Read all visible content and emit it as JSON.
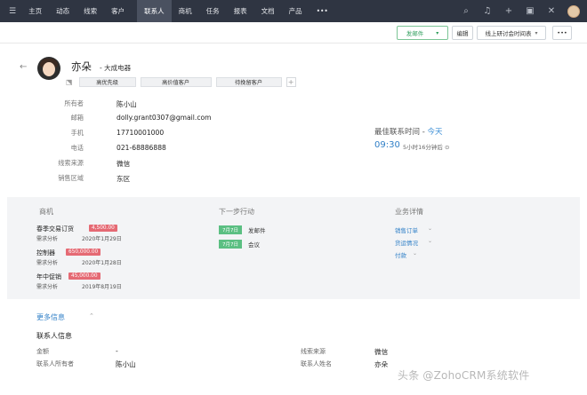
{
  "topnav": {
    "items": [
      "主页",
      "动态",
      "线索",
      "客户",
      "联系人",
      "商机",
      "任务",
      "报表",
      "文档",
      "产品",
      "•••"
    ],
    "active_index": 4
  },
  "actionbar": {
    "send_email": "发邮件",
    "send_email_caret": "▾",
    "edit": "编辑",
    "meeting": "线上研讨会时间表",
    "meeting_caret": "▾",
    "more": "•••"
  },
  "contact": {
    "name": "亦朵",
    "company": "- 大成电器",
    "tags": [
      "高优先级",
      "高价值客户",
      "待挽留客户"
    ],
    "tag_add": "+"
  },
  "fields": [
    {
      "label": "所有者",
      "value": "陈小山"
    },
    {
      "label": "邮箱",
      "value": "dolly.grant0307@gmail.com"
    },
    {
      "label": "手机",
      "value": "17710001000"
    },
    {
      "label": "电话",
      "value": "021-68886888"
    },
    {
      "label": "线索来源",
      "value": "微信"
    },
    {
      "label": "销售区域",
      "value": "东区"
    }
  ],
  "best_time": {
    "label": "最佳联系时间",
    "sep": " - ",
    "today": "今天",
    "time": "09:30",
    "relative": "5小时16分钟后"
  },
  "overview": {
    "deals_title": "商机",
    "deals": [
      {
        "name": "春季交易订货",
        "amount": "4,500.00",
        "stage": "需求分析",
        "date": "2020年1月29日"
      },
      {
        "name": "控制器",
        "amount": "650,000.00",
        "stage": "需求分析",
        "date": "2020年1月28日"
      },
      {
        "name": "年中促销",
        "amount": "45,000.00",
        "stage": "需求分析",
        "date": "2019年8月19日"
      }
    ],
    "next_title": "下一步行动",
    "actions": [
      {
        "date": "7月7日",
        "name": "发邮件"
      },
      {
        "date": "7月7日",
        "name": "会议"
      }
    ],
    "biz_title": "业务详情",
    "biz_links": [
      "销售订单",
      "货运情况",
      "付款"
    ]
  },
  "more_info": {
    "title": "更多信息",
    "section_title": "联系人信息",
    "rows": [
      {
        "l1": "金额",
        "v1": "-",
        "l2": "线索来源",
        "v2": "微信"
      },
      {
        "l1": "联系人所有者",
        "v1": "陈小山",
        "l2": "联系人姓名",
        "v2": "亦朵"
      }
    ]
  },
  "watermark": "头条 @ZohoCRM系统软件"
}
